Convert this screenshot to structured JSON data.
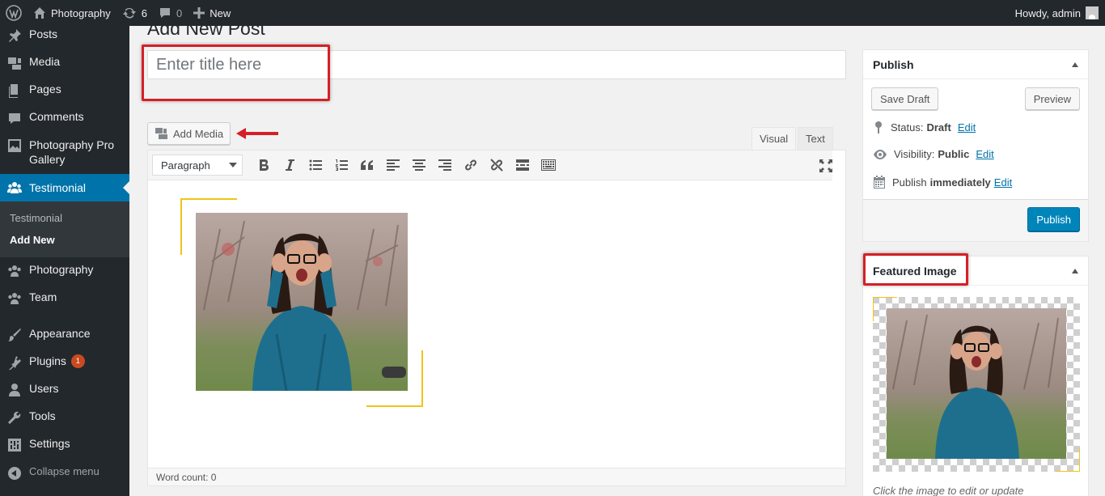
{
  "adminbar": {
    "site_name": "Photography",
    "updates_count": "6",
    "comments_count": "0",
    "new_label": "New",
    "howdy": "Howdy, admin"
  },
  "sidebar": {
    "items": [
      {
        "label": "Posts",
        "icon": "pin-icon"
      },
      {
        "label": "Media",
        "icon": "media-icon"
      },
      {
        "label": "Pages",
        "icon": "pages-icon"
      },
      {
        "label": "Comments",
        "icon": "comment-icon"
      },
      {
        "label": "Photography Pro Gallery",
        "icon": "gallery-icon"
      },
      {
        "label": "Testimonial",
        "icon": "groups-icon"
      },
      {
        "label": "Photography",
        "icon": "groups-icon"
      },
      {
        "label": "Team",
        "icon": "groups-icon"
      },
      {
        "label": "Appearance",
        "icon": "brush-icon"
      },
      {
        "label": "Plugins",
        "icon": "plugin-icon"
      },
      {
        "label": "Users",
        "icon": "user-icon"
      },
      {
        "label": "Tools",
        "icon": "wrench-icon"
      },
      {
        "label": "Settings",
        "icon": "settings-icon"
      }
    ],
    "submenu": [
      "Testimonial",
      "Add New"
    ],
    "plugins_badge": "1",
    "collapse_label": "Collapse menu"
  },
  "main": {
    "page_title": "Add New Post",
    "title_placeholder": "Enter title here",
    "add_media_label": "Add Media",
    "tabs": [
      "Visual",
      "Text"
    ],
    "format_select": "Paragraph",
    "word_count": "Word count: 0"
  },
  "publish": {
    "heading": "Publish",
    "save_draft": "Save Draft",
    "preview": "Preview",
    "status_label": "Status:",
    "status_value": "Draft",
    "visibility_label": "Visibility:",
    "visibility_value": "Public",
    "publish_label": "Publish",
    "publish_value": "immediately",
    "edit_link": "Edit",
    "publish_button": "Publish"
  },
  "featured": {
    "heading": "Featured Image",
    "hint": "Click the image to edit or update"
  },
  "colors": {
    "accent": "#0073aa",
    "highlight": "#d61f26",
    "frame": "#f0c419"
  }
}
